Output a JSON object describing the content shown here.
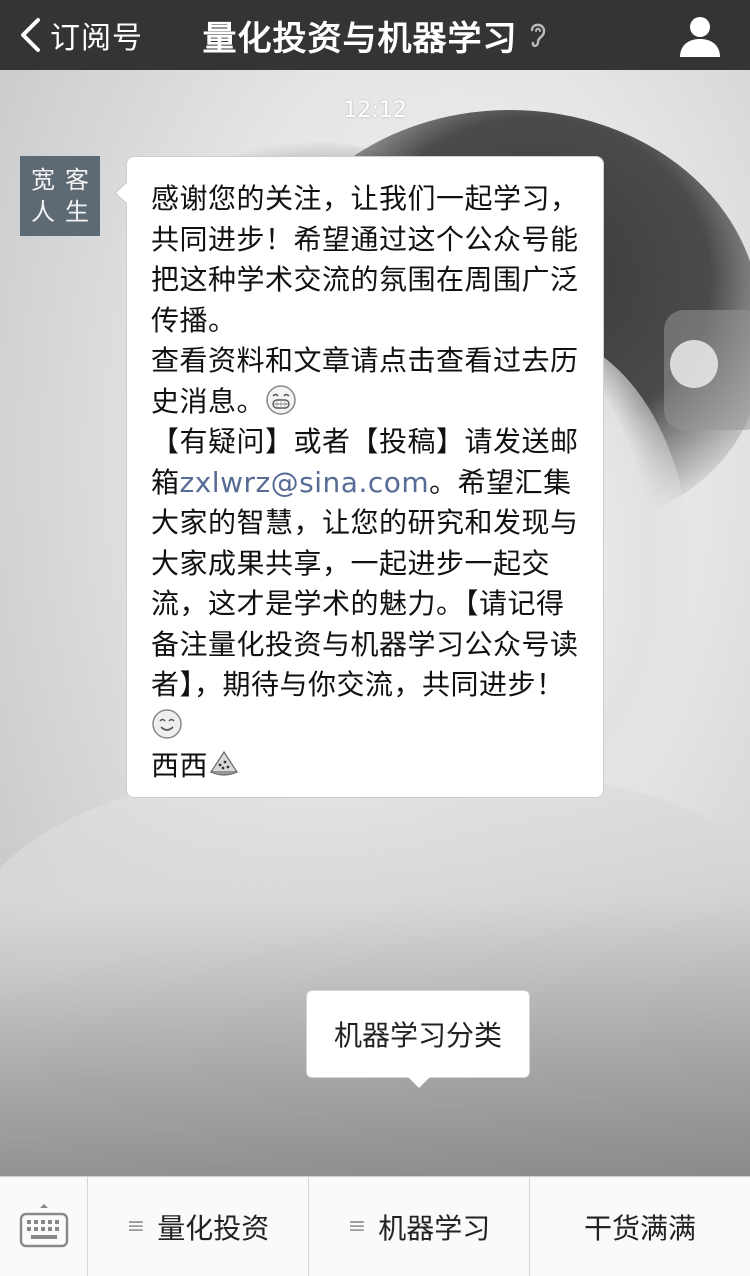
{
  "navbar": {
    "back_label": "订阅号",
    "title": "量化投资与机器学习"
  },
  "chat": {
    "timestamp": "12:12",
    "avatar_chars": [
      "宽",
      "客",
      "人",
      "生"
    ],
    "message": {
      "part1": "感谢您的关注，让我们一起学习，共同进步！希望通过这个公众号能把这种学术交流的氛围在周围广泛传播。",
      "part2": "查看资料和文章请点击查看过去历史消息。",
      "part3_prefix": "【有疑问】或者【投稿】请发送邮箱",
      "email": "zxlwrz@sina.com",
      "part3_suffix": "。希望汇集大家的智慧，让您的研究和发现与大家成果共享，一起进步一起交流，这才是学术的魅力。【请记得备注量化投资与机器学习公众号读者】，期待与你交流，共同进步！",
      "part4": "西西"
    }
  },
  "submenu": {
    "item": "机器学习分类"
  },
  "bottom_menu": {
    "items": [
      {
        "label": "量化投资",
        "icon": "menu-lines-icon"
      },
      {
        "label": "机器学习",
        "icon": "menu-lines-icon"
      },
      {
        "label": "干货满满"
      }
    ]
  }
}
